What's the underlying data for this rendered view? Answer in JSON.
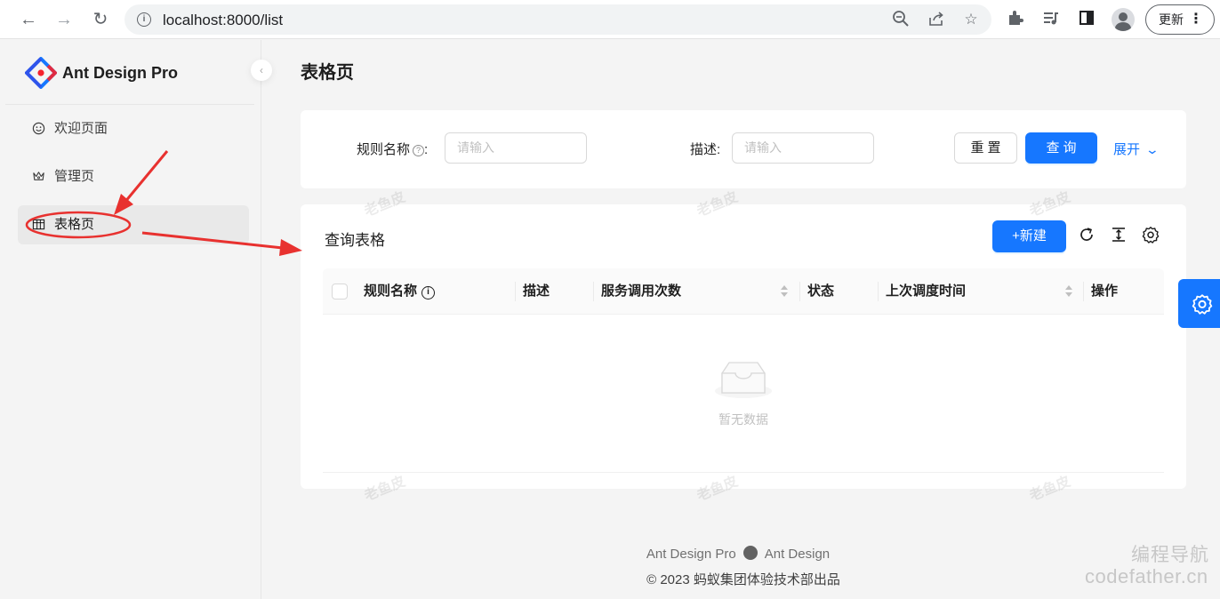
{
  "browser": {
    "url": "localhost:8000/list",
    "update_label": "更新",
    "icons": [
      "back-icon",
      "forward-icon",
      "reload-icon",
      "site-info-icon",
      "zoom-icon",
      "share-icon",
      "bookmark-star-icon",
      "extensions-icon",
      "media-icon",
      "side-panel-icon",
      "profile-icon",
      "menu-icon"
    ]
  },
  "sidebar": {
    "brand": "Ant Design Pro",
    "items": [
      {
        "label": "欢迎页面",
        "icon": "smile-icon",
        "active": false
      },
      {
        "label": "管理页",
        "icon": "crown-icon",
        "active": false
      },
      {
        "label": "表格页",
        "icon": "table-icon",
        "active": true
      }
    ]
  },
  "page": {
    "title": "表格页"
  },
  "search_form": {
    "rule_name_label": "规则名称",
    "rule_name_placeholder": "请输入",
    "desc_label": "描述",
    "desc_placeholder": "请输入",
    "reset_label": "重置",
    "query_label": "查询",
    "expand_label": "展开"
  },
  "table": {
    "title": "查询表格",
    "new_label": "+新建",
    "columns": [
      {
        "label": "规则名称",
        "info": true,
        "sortable": false
      },
      {
        "label": "描述",
        "sortable": false
      },
      {
        "label": "服务调用次数",
        "sortable": true
      },
      {
        "label": "状态",
        "sortable": false
      },
      {
        "label": "上次调度时间",
        "sortable": true
      },
      {
        "label": "操作",
        "sortable": false
      }
    ],
    "rows": [],
    "empty_text": "暂无数据"
  },
  "watermark": "老鱼皮",
  "footer": {
    "link1": "Ant Design Pro",
    "link2": "Ant Design",
    "copyright": "2023 蚂蚁集团体验技术部出品"
  },
  "site_watermark": {
    "line1": "编程导航",
    "line2": "codefather.cn"
  },
  "colors": {
    "primary": "#1677ff",
    "annotation": "#e8312f"
  }
}
